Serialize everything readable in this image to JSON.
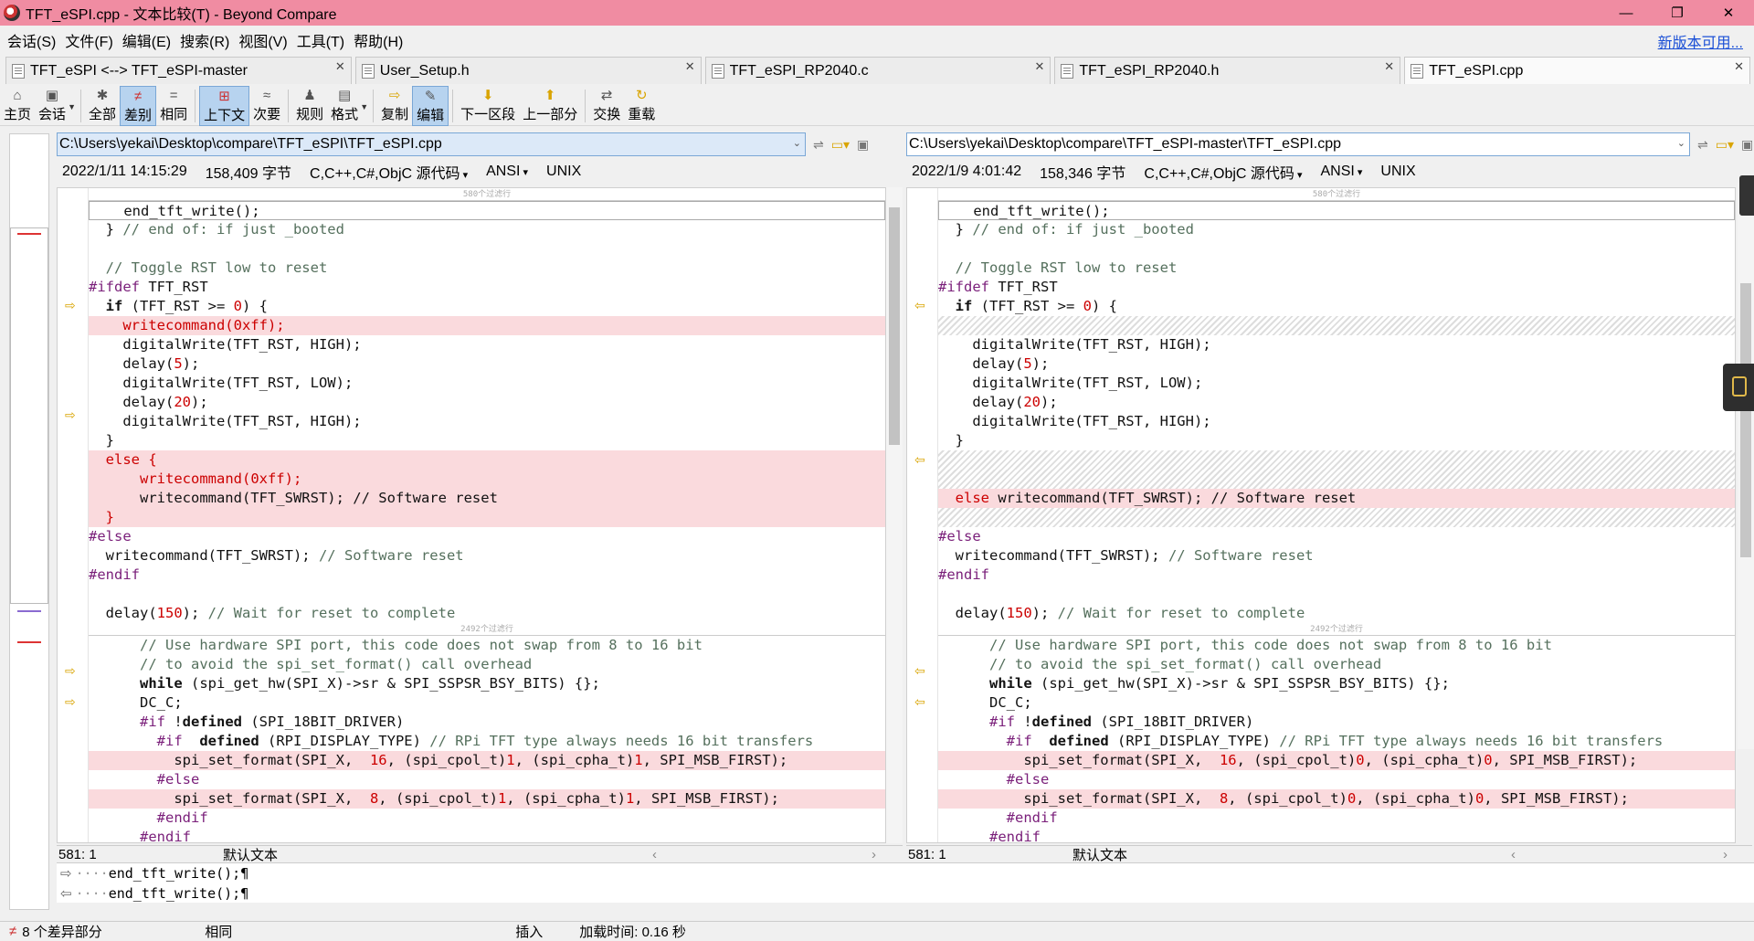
{
  "window": {
    "title": "TFT_eSPI.cpp - 文本比较(T) - Beyond Compare",
    "minimize": "—",
    "maximize": "❐",
    "close": "✕"
  },
  "menu": [
    "会话(S)",
    "文件(F)",
    "编辑(E)",
    "搜索(R)",
    "视图(V)",
    "工具(T)",
    "帮助(H)"
  ],
  "update_link": "新版本可用...",
  "tabs": [
    {
      "label": "TFT_eSPI <--> TFT_eSPI-master",
      "active": false
    },
    {
      "label": "User_Setup.h",
      "active": false
    },
    {
      "label": "TFT_eSPI_RP2040.c",
      "active": false
    },
    {
      "label": "TFT_eSPI_RP2040.h",
      "active": false
    },
    {
      "label": "TFT_eSPI.cpp",
      "active": true
    }
  ],
  "toolbar": [
    {
      "label": "主页",
      "icon": "home-icon",
      "glyph": "⌂",
      "on": false,
      "dd": false
    },
    {
      "label": "会话",
      "icon": "session-icon",
      "glyph": "▣",
      "on": false,
      "dd": true
    },
    {
      "label": "全部",
      "icon": "all-icon",
      "glyph": "✱",
      "on": false,
      "dd": false
    },
    {
      "label": "差别",
      "icon": "diff-icon",
      "glyph": "≠",
      "on": true,
      "dd": false
    },
    {
      "label": "相同",
      "icon": "same-icon",
      "glyph": "=",
      "on": false,
      "dd": false
    },
    {
      "label": "上下文",
      "icon": "context-icon",
      "glyph": "⊞",
      "on": true,
      "dd": false
    },
    {
      "label": "次要",
      "icon": "minor-icon",
      "glyph": "≈",
      "on": false,
      "dd": false
    },
    {
      "label": "规则",
      "icon": "rules-icon",
      "glyph": "♟",
      "on": false,
      "dd": false
    },
    {
      "label": "格式",
      "icon": "format-icon",
      "glyph": "▤",
      "on": false,
      "dd": true
    },
    {
      "label": "复制",
      "icon": "copy-icon",
      "glyph": "⇨",
      "on": false,
      "dd": false
    },
    {
      "label": "编辑",
      "icon": "edit-icon",
      "glyph": "✎",
      "on": true,
      "dd": false
    },
    {
      "label": "下一区段",
      "icon": "next-section-icon",
      "glyph": "⬇",
      "on": false,
      "dd": false
    },
    {
      "label": "上一部分",
      "icon": "prev-section-icon",
      "glyph": "⬆",
      "on": false,
      "dd": false
    },
    {
      "label": "交换",
      "icon": "swap-icon",
      "glyph": "⇄",
      "on": false,
      "dd": false
    },
    {
      "label": "重载",
      "icon": "reload-icon",
      "glyph": "↻",
      "on": false,
      "dd": false
    }
  ],
  "left": {
    "path": "C:\\Users\\yekai\\Desktop\\compare\\TFT_eSPI\\TFT_eSPI.cpp",
    "date": "2022/1/11 14:15:29",
    "size": "158,409 字节",
    "lang": "C,C++,C#,ObjC 源代码",
    "encoding": "ANSI",
    "eol": "UNIX",
    "pos": "581: 1",
    "mode": "默认文本"
  },
  "right": {
    "path": "C:\\Users\\yekai\\Desktop\\compare\\TFT_eSPI-master\\TFT_eSPI.cpp",
    "date": "2022/1/9 4:01:42",
    "size": "158,346 字节",
    "lang": "C,C++,C#,ObjC 源代码",
    "encoding": "ANSI",
    "eol": "UNIX",
    "pos": "581: 1",
    "mode": "默认文本"
  },
  "fold_top": "580个过滤行",
  "fold_mid": "2492个过滤行",
  "bottom_rows": [
    "end_tft_write();¶",
    "end_tft_write();¶"
  ],
  "status": {
    "diffs": "8 个差异部分",
    "same": "相同",
    "insert": "插入",
    "load_time": "加载时间:  0.16 秒"
  }
}
